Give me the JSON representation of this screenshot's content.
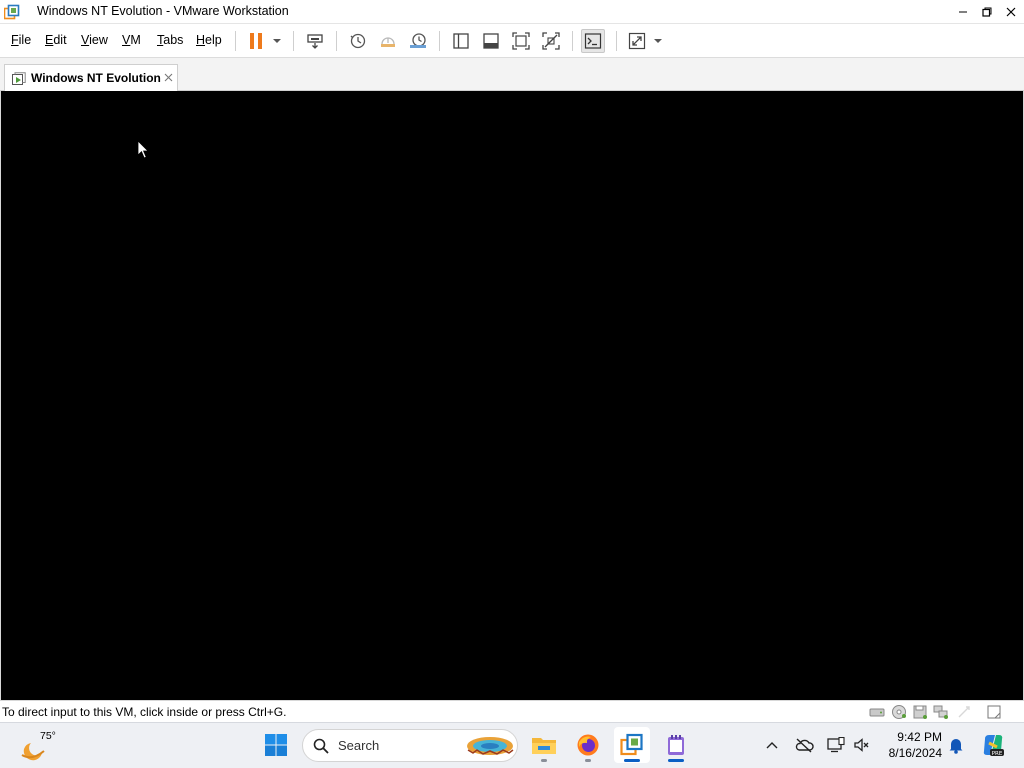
{
  "window": {
    "title": "Windows NT Evolution - VMware Workstation",
    "app_icon": "vmware-icon",
    "controls": [
      "minimize-icon",
      "maximize-icon",
      "close-icon"
    ]
  },
  "menu": {
    "items": [
      {
        "label": "File",
        "accel": "F",
        "rest": "ile"
      },
      {
        "label": "Edit",
        "accel": "E",
        "rest": "dit"
      },
      {
        "label": "View",
        "accel": "V",
        "rest": "iew"
      },
      {
        "label": "VM",
        "accel": "V",
        "rest": "M"
      },
      {
        "label": "Tabs",
        "accel": "T",
        "rest": "abs"
      },
      {
        "label": "Help",
        "accel": "H",
        "rest": "elp"
      }
    ]
  },
  "toolbar": {
    "buttons": [
      "pause-icon",
      "send-ctrl-alt-del-icon",
      "take-snapshot-icon",
      "revert-snapshot-icon",
      "snapshot-manager-icon",
      "show-library-icon",
      "show-thumbnail-bar-icon",
      "full-screen-icon",
      "unity-icon",
      "console-view-icon",
      "stretch-guest-icon"
    ],
    "accent": "#ee7a1c"
  },
  "tabs": [
    {
      "label": "Windows NT Evolution",
      "icon": "vm-tab-icon",
      "active": true
    }
  ],
  "vm": {
    "screen_color": "#000000"
  },
  "statusbar": {
    "message": "To direct input to this VM, click inside or press Ctrl+G.",
    "device_icons": [
      "hard-disk-icon",
      "cd-dvd-icon",
      "floppy-icon",
      "network-adapter-icon",
      "usb-icon",
      "message-log-icon"
    ]
  },
  "taskbar": {
    "weather": {
      "temperature": "75°",
      "icon": "weather-moon-icon"
    },
    "search_placeholder": "Search",
    "apps": [
      "start-icon",
      "search-icon",
      "file-explorer-icon",
      "firefox-icon",
      "vmware-workstation-icon",
      "notepad-icon"
    ],
    "tray": [
      "show-hidden-icons-icon",
      "onedrive-offline-icon",
      "display-network-icon",
      "volume-muted-icon",
      "notification-bell-icon",
      "copilot-icon"
    ],
    "clock": {
      "time": "9:42 PM",
      "date": "8/16/2024"
    }
  }
}
